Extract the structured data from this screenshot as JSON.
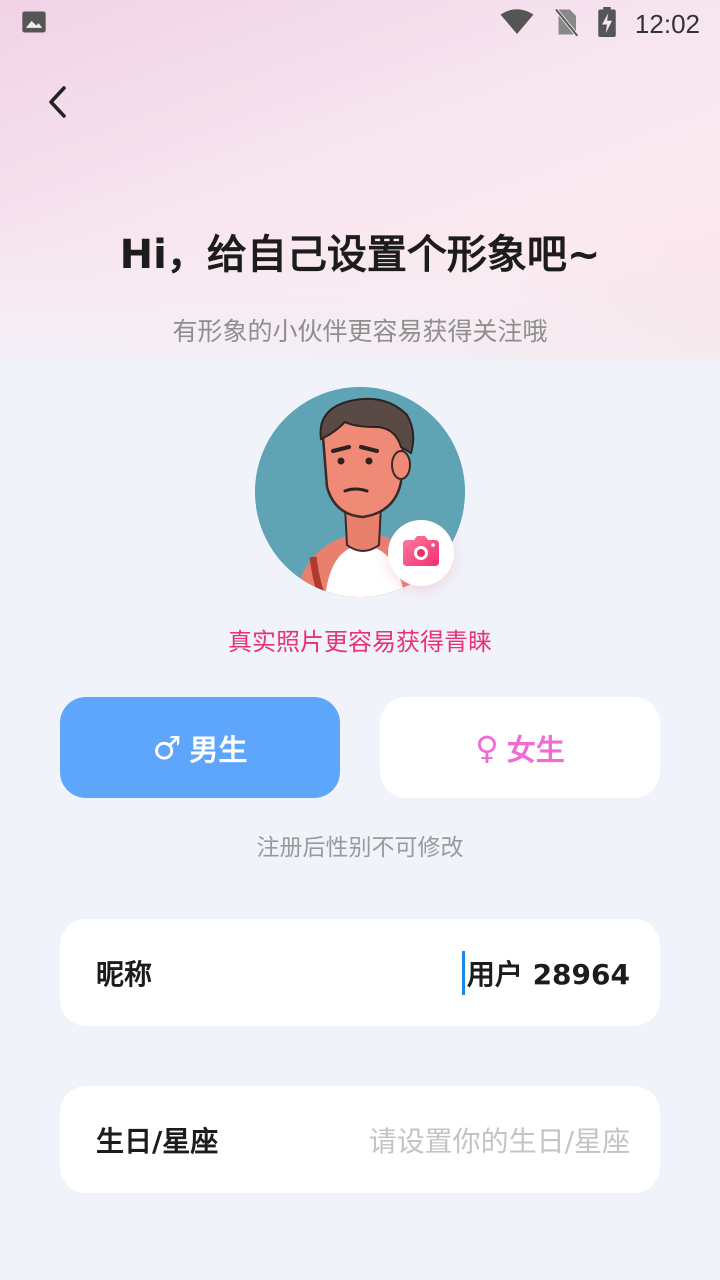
{
  "status_bar": {
    "time": "12:02",
    "icons": [
      "image-icon",
      "wifi-icon",
      "no-sim-icon",
      "battery-charging-icon"
    ]
  },
  "header": {
    "back_icon": "chevron-left-icon",
    "title": "Hi，给自己设置个形象吧~",
    "subtitle": "有形象的小伙伴更容易获得关注哦"
  },
  "avatar": {
    "camera_icon": "camera-icon",
    "tip": "真实照片更容易获得青睐"
  },
  "gender": {
    "male_symbol": "♂",
    "male_label": "男生",
    "female_symbol": "♀",
    "female_label": "女生",
    "selected": "male",
    "note": "注册后性别不可修改"
  },
  "form": {
    "nickname_label": "昵称",
    "nickname_value": "用户 28964",
    "birthday_label": "生日/星座",
    "birthday_placeholder": "请设置你的生日/星座"
  },
  "colors": {
    "accent_blue": "#5ea5fc",
    "accent_pink": "#e8317a",
    "female_pink": "#f06bd4",
    "background": "#f1f3fb"
  }
}
